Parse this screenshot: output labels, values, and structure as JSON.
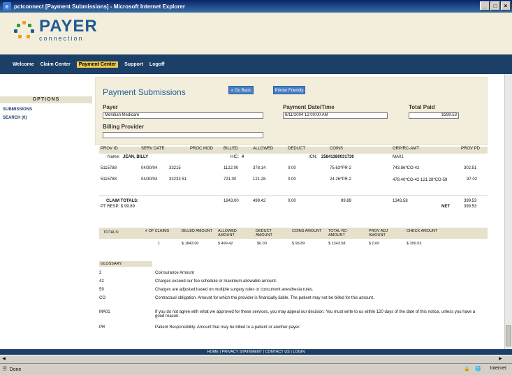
{
  "window": {
    "title": "pctconnect [Payment Submissions] - Microsoft Internet Explorer",
    "controls": [
      "_",
      "□",
      "×"
    ]
  },
  "logo": {
    "line1": "PAYER",
    "line2": "connection"
  },
  "nav": {
    "items": [
      "Welcome",
      "Claim Center",
      "Payment Center",
      "Support",
      "Logoff"
    ],
    "active": "Payment Center"
  },
  "sidebar": {
    "options_label": "OPTIONS",
    "items": [
      "SUBMISSIONS",
      "SEARCH (0)"
    ]
  },
  "page": {
    "title": "Payment Submissions",
    "go_back": "« Go Back",
    "printer_friendly": "Printer Friendly",
    "payer_label": "Payer",
    "payer_value": "Meridian Medicare",
    "datetime_label": "Payment Date/Time",
    "datetime_value": "8/11/2004 12:00:00 AM",
    "total_paid_label": "Total Paid",
    "total_paid_value": "$399.53",
    "billing_provider_label": "Billing Provider",
    "billing_provider_value": ""
  },
  "claims_table": {
    "headers": [
      "PROV ID",
      "SERV DATE",
      "PROC MOD",
      "BILLED",
      "ALLOWED",
      "DEDUCT",
      "COINS",
      "GRP/RC-AMT",
      "PROV PD"
    ],
    "name_row": {
      "name_label": "Name:",
      "name_value": "JEAN, BILLY",
      "hic_label": "HIC:",
      "hic_value": "#",
      "icn_label": "ICN:",
      "icn_value": "25841380031730",
      "ma_code": "MA01"
    },
    "rows": [
      [
        "5115788",
        "04/30/04",
        "33215",
        "1122.00",
        "378.14",
        "0.00",
        "75.63*PR-2",
        "743.86*CO-42",
        "302.51"
      ],
      [
        "5115788",
        "04/30/04",
        "33233 51",
        "721.00",
        "121.28",
        "0.00",
        "24.26*PR-2",
        "478.40*CO-42 121.28*CO-59",
        "97.02"
      ]
    ],
    "claim_totals": {
      "label": "CLAIM TOTALS:",
      "billed": "1843.00",
      "allowed": "499.42",
      "deduct": "0.00",
      "coins": "99.89",
      "grp": "1343.58",
      "prov_pd": "399.53",
      "pt_resp": "PT RESP: $ 99.89",
      "net_label": "NET",
      "net_value": "399.53"
    }
  },
  "totals_table": {
    "headers": [
      "TOTALS:",
      "# OF CLAIMS",
      "BILLED AMOUNT",
      "ALLOWED AMOUNT",
      "DEDUCT AMOUNT",
      "COINS AMOUNT",
      "TOTAL RC-AMOUNT",
      "PROV ADJ AMOUNT",
      "CHECK AMOUNT"
    ],
    "values": [
      "",
      "1",
      "$ 1843.00",
      "$ 499.42",
      "$0.00",
      "$ 99.89",
      "$ 1343.58",
      "$ 0.00",
      "$ 399.53"
    ]
  },
  "glossary": {
    "label": "GLOSSARY:",
    "items": [
      {
        "code": "2",
        "desc": "Coinsurance Amount"
      },
      {
        "code": "42",
        "desc": "Charges exceed our fee schedule or maximum allowable amount."
      },
      {
        "code": "59",
        "desc": "Charges are adjusted based on multiple surgery rules or concurrent anesthesia rules."
      },
      {
        "code": "CO",
        "desc": "Contractual obligation. Amount for which the provider is financially liable. The patient may not be billed for this amount."
      },
      {
        "code": "MA01",
        "desc": "If you do not agree with what we approved for these services, you may appeal our decision. You must write to us within 120 days of the date of this notice, unless you have a good reason."
      },
      {
        "code": "PR",
        "desc": "Patient Responsibility. Amount that may be billed to a patient or another payer."
      }
    ]
  },
  "footer": {
    "text": "HOME | PRIVACY STATEMENT | CONTACT US | LOGIN"
  },
  "status": {
    "left": "Done",
    "zone": "Internet"
  },
  "colors": {
    "nav_bg": "#1b3f66",
    "active_tab": "#f0c750",
    "panel_bg": "#f3eedb",
    "accent_blue": "#2060a0"
  }
}
